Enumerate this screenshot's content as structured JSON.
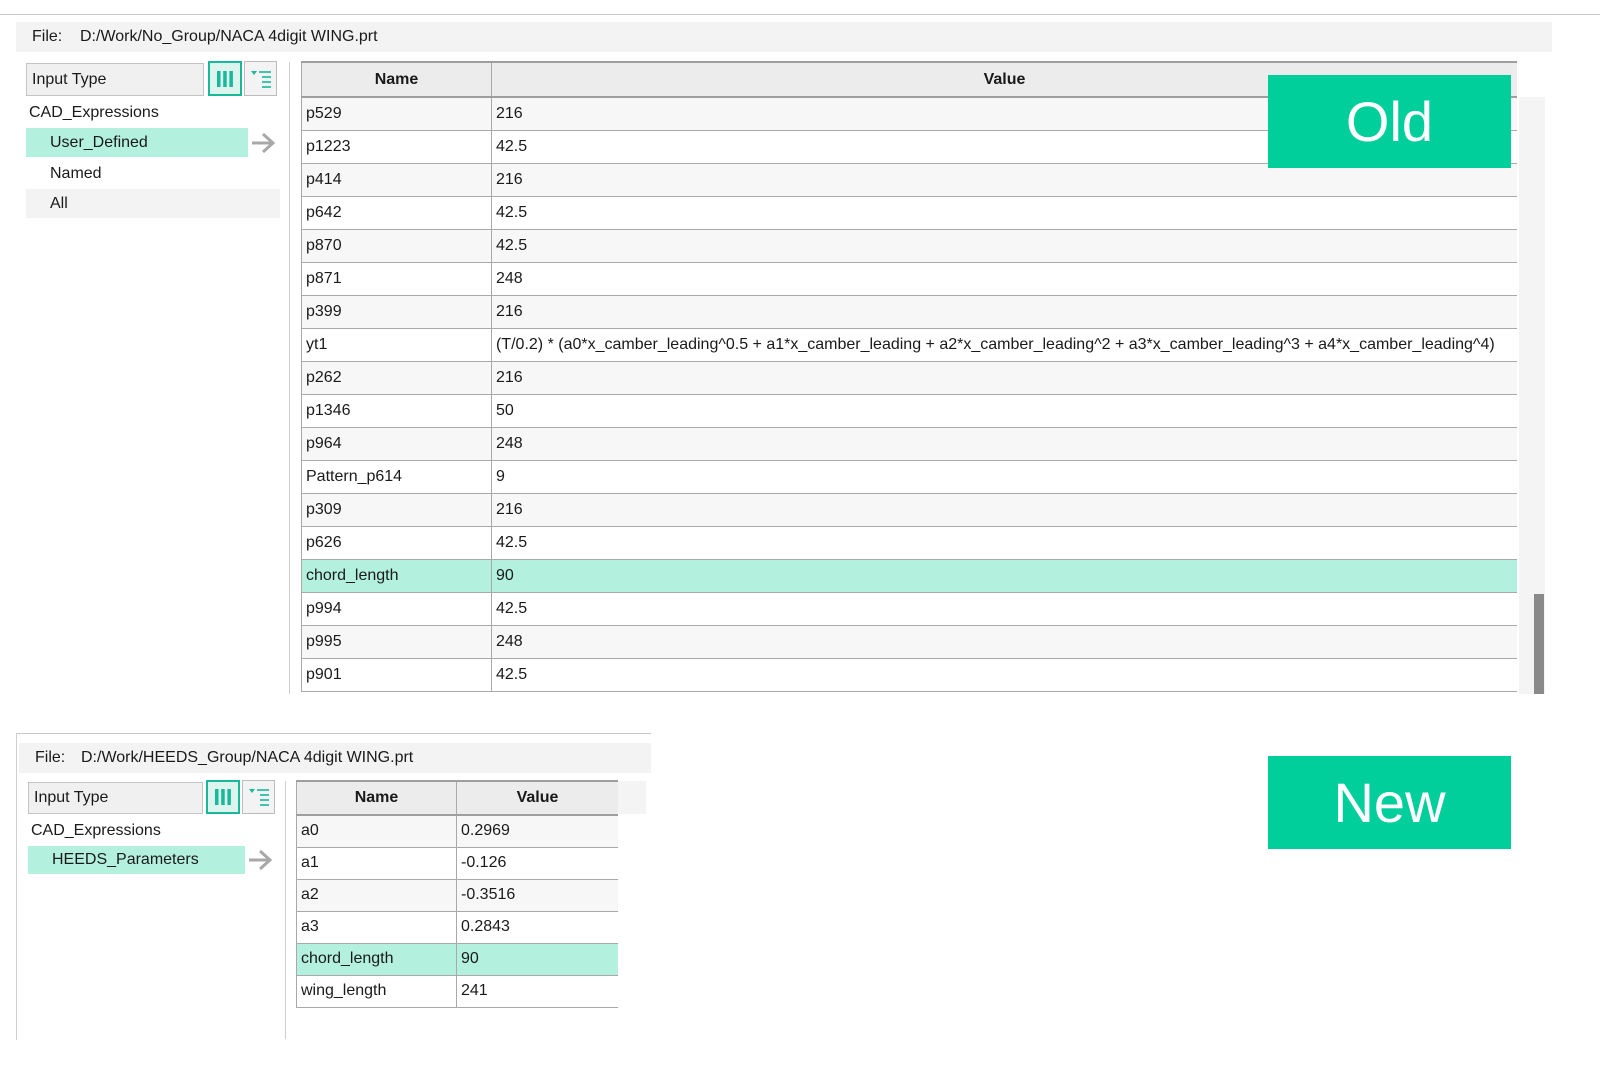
{
  "colors": {
    "accent": "#00cf9c",
    "selection": "#b3f0dd",
    "toggle_border": "#17b99a"
  },
  "old": {
    "file_label": "File:",
    "file_path": "D:/Work/No_Group/NACA 4digit WING.prt",
    "input_type": "Input Type",
    "view_buttons": {
      "columns_icon": "columns-icon",
      "tree_icon": "tree-list-icon"
    },
    "tree": {
      "root": "CAD_Expressions",
      "items": [
        "User_Defined",
        "Named",
        "All"
      ]
    },
    "table": {
      "headers": [
        "Name",
        "Value"
      ],
      "rows": [
        [
          "p529",
          "216"
        ],
        [
          "p1223",
          "42.5"
        ],
        [
          "p414",
          "216"
        ],
        [
          "p642",
          "42.5"
        ],
        [
          "p870",
          "42.5"
        ],
        [
          "p871",
          "248"
        ],
        [
          "p399",
          "216"
        ],
        [
          "yt1",
          "(T/0.2) * (a0*x_camber_leading^0.5 + a1*x_camber_leading + a2*x_camber_leading^2 + a3*x_camber_leading^3 + a4*x_camber_leading^4)"
        ],
        [
          "p262",
          "216"
        ],
        [
          "p1346",
          "50"
        ],
        [
          "p964",
          "248"
        ],
        [
          "Pattern_p614",
          "9"
        ],
        [
          "p309",
          "216"
        ],
        [
          "p626",
          "42.5"
        ],
        [
          "chord_length",
          "90"
        ],
        [
          "p994",
          "42.5"
        ],
        [
          "p995",
          "248"
        ],
        [
          "p901",
          "42.5"
        ]
      ],
      "selected_row": "chord_length"
    },
    "badge": "Old"
  },
  "new": {
    "file_label": "File:",
    "file_path": "D:/Work/HEEDS_Group/NACA 4digit WING.prt",
    "input_type": "Input Type",
    "view_buttons": {
      "columns_icon": "columns-icon",
      "tree_icon": "tree-list-icon"
    },
    "tree": {
      "root": "CAD_Expressions",
      "items": [
        "HEEDS_Parameters"
      ]
    },
    "table": {
      "headers": [
        "Name",
        "Value"
      ],
      "rows": [
        [
          "a0",
          "0.2969"
        ],
        [
          "a1",
          "-0.126"
        ],
        [
          "a2",
          "-0.3516"
        ],
        [
          "a3",
          "0.2843"
        ],
        [
          "chord_length",
          "90"
        ],
        [
          "wing_length",
          "241"
        ]
      ],
      "selected_row": "chord_length"
    },
    "badge": "New"
  }
}
